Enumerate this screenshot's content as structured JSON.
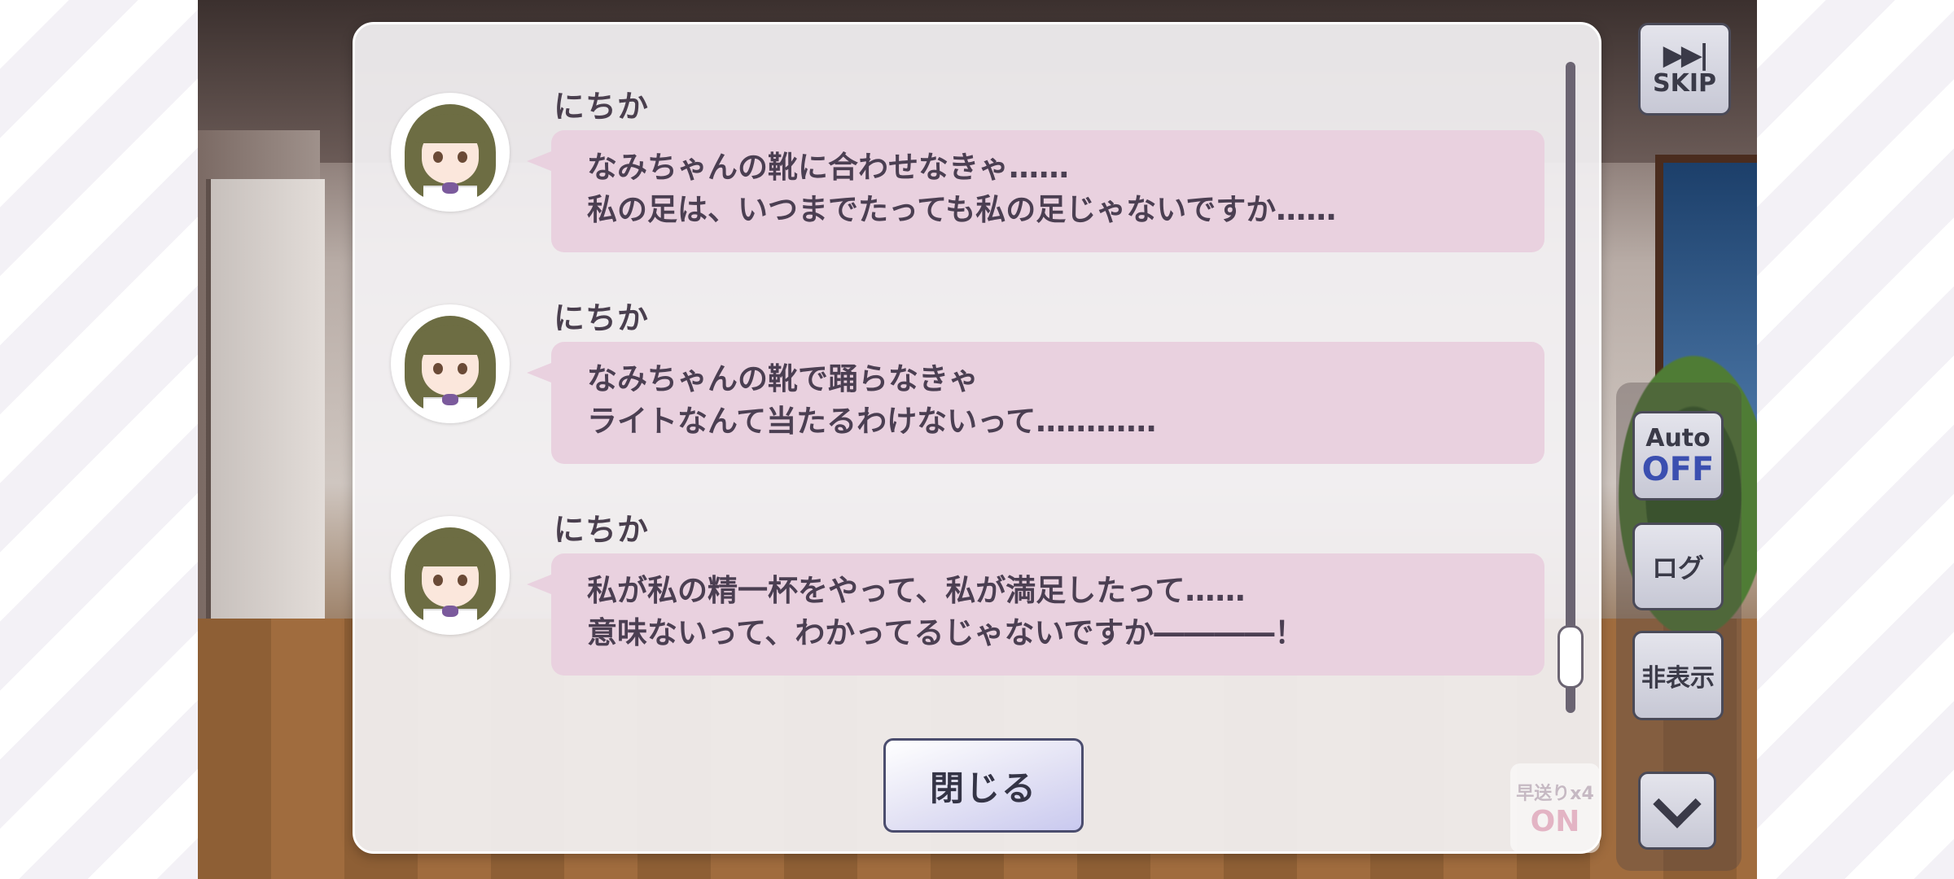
{
  "log": {
    "entries": [
      {
        "speaker": "にちか",
        "lines": [
          "なみちゃんの靴に合わせなきゃ……",
          "私の足は、いつまでたっても私の足じゃないですか……"
        ]
      },
      {
        "speaker": "にちか",
        "lines": [
          "なみちゃんの靴で踊らなきゃ",
          "ライトなんて当たるわけないって…………"
        ]
      },
      {
        "speaker": "にちか",
        "lines": [
          "私が私の精一杯をやって、私が満足したって……",
          "意味ないって、わかってるじゃないですか――――！"
        ]
      }
    ],
    "close_label": "閉じる"
  },
  "controls": {
    "skip_icon": "▶▶|",
    "skip_label": "SKIP",
    "auto_label": "Auto",
    "auto_state": "OFF",
    "log_label": "ログ",
    "hide_label": "非表示",
    "fast_label": "早送りx4",
    "fast_state": "ON"
  },
  "icons": {
    "skip": "skip-forward-icon",
    "down": "chevron-down-icon"
  },
  "colors": {
    "bubble": "#e9d1df",
    "text": "#4b3f52",
    "auto_off": "#3b4fb0"
  }
}
